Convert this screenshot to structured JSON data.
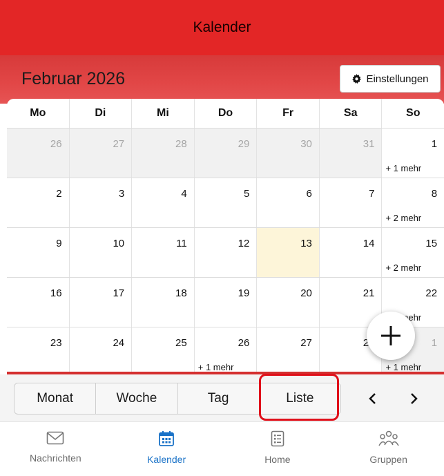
{
  "header": {
    "title": "Kalender"
  },
  "calendar": {
    "month_title": "Februar 2026",
    "settings_label": "Einstellungen",
    "weekdays": [
      "Mo",
      "Di",
      "Mi",
      "Do",
      "Fr",
      "Sa",
      "So"
    ],
    "weeks": [
      [
        "26",
        "27",
        "28",
        "29",
        "30",
        "31",
        "1"
      ],
      [
        "2",
        "3",
        "4",
        "5",
        "6",
        "7",
        "8"
      ],
      [
        "9",
        "10",
        "11",
        "12",
        "13",
        "14",
        "15"
      ],
      [
        "16",
        "17",
        "18",
        "19",
        "20",
        "21",
        "22"
      ],
      [
        "23",
        "24",
        "25",
        "26",
        "27",
        "28",
        "1"
      ]
    ],
    "more": {
      "w0_so": "+ 1 mehr",
      "w1_so": "+ 2 mehr",
      "w2_so": "+ 2 mehr",
      "w3_so": "+ 2 mehr",
      "w4_do": "+ 1 mehr",
      "w4_so": "+ 1 mehr"
    }
  },
  "view_switch": {
    "month": "Monat",
    "week": "Woche",
    "day": "Tag",
    "list": "Liste"
  },
  "tabs": {
    "messages": "Nachrichten",
    "calendar": "Kalender",
    "home": "Home",
    "groups": "Gruppen"
  },
  "colors": {
    "header_red": "#e32626",
    "highlight_red": "#e0101a",
    "today_bg": "#fdf5d9",
    "active_tab_blue": "#1a72c7"
  },
  "icons": [
    "gear-icon",
    "plus-icon",
    "chevron-left-icon",
    "chevron-right-icon",
    "envelope-icon",
    "calendar-icon",
    "home-list-icon",
    "groups-icon"
  ]
}
